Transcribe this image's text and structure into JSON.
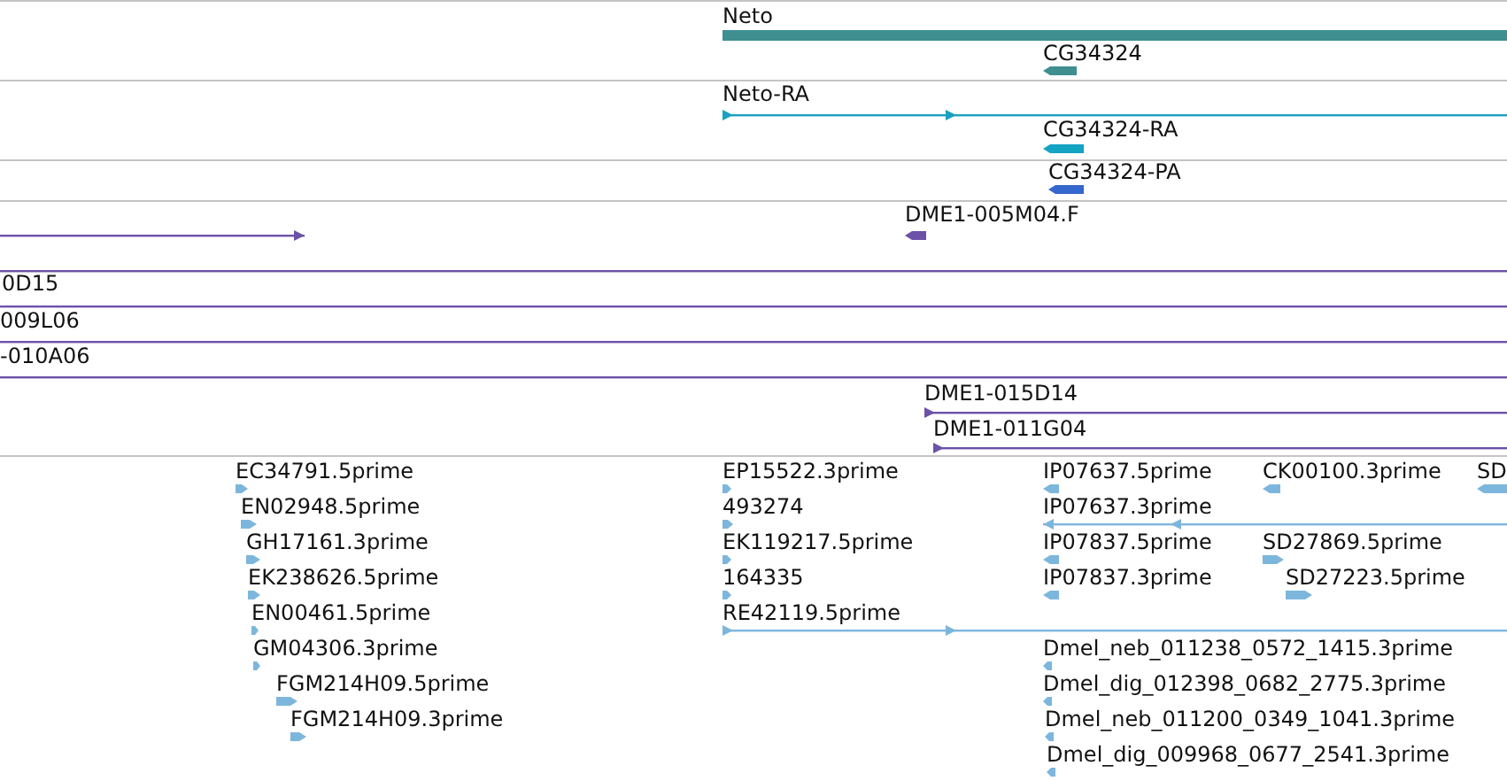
{
  "tracks": [
    {
      "features": [
        {
          "label": "Neto",
          "kind": "bar",
          "color": "#3f8f91"
        },
        {
          "label": "CG34324",
          "kind": "arrow",
          "reverse": true,
          "color": "#3f8f91"
        }
      ]
    },
    {
      "features": [
        {
          "label": "Neto-RA",
          "kind": "line",
          "reverse": false,
          "color": "#1aa0c0"
        },
        {
          "label": "CG34324-RA",
          "kind": "arrow",
          "reverse": true,
          "color": "#13a3c3"
        }
      ]
    },
    {
      "features": [
        {
          "label": "CG34324-PA",
          "kind": "arrow",
          "reverse": true,
          "color": "#3567cc"
        }
      ]
    },
    {
      "features": [
        {
          "kind": "line",
          "reverse": false,
          "color": "#6b52a8"
        },
        {
          "label": "DME1-005M04.F",
          "kind": "arrow",
          "reverse": true,
          "color": "#6b52a8"
        },
        {
          "kind": "line",
          "color": "#6b52a8"
        },
        {
          "label": "0D15",
          "kind": "line",
          "color": "#6b52a8"
        },
        {
          "label": "009L06",
          "kind": "line",
          "color": "#6b52a8"
        },
        {
          "label": "-010A06",
          "kind": "line",
          "color": "#6b52a8"
        },
        {
          "label": "DME1-015D14",
          "kind": "line",
          "reverse": false,
          "color": "#6b52a8"
        },
        {
          "label": "DME1-011G04",
          "kind": "line",
          "reverse": false,
          "color": "#6b52a8"
        }
      ]
    },
    {
      "features": [
        {
          "label": "EC34791.5prime",
          "kind": "arrow",
          "reverse": false,
          "color": "#7db6dc"
        },
        {
          "label": "EP15522.3prime",
          "kind": "arrow",
          "reverse": false,
          "color": "#7db6dc"
        },
        {
          "label": "IP07637.5prime",
          "kind": "arrow",
          "reverse": true,
          "color": "#7db6dc"
        },
        {
          "label": "CK00100.3prime",
          "kind": "arrow",
          "reverse": true,
          "color": "#7db6dc"
        },
        {
          "label": "SD",
          "kind": "arrow",
          "reverse": true,
          "color": "#7db6dc"
        },
        {
          "label": "EN02948.5prime",
          "kind": "arrow",
          "reverse": false,
          "color": "#7db6dc"
        },
        {
          "label": "493274",
          "kind": "arrow",
          "reverse": false,
          "color": "#7db6dc"
        },
        {
          "label": "IP07637.3prime",
          "kind": "line",
          "reverse": true,
          "color": "#7db6dc"
        },
        {
          "label": "GH17161.3prime",
          "kind": "arrow",
          "reverse": false,
          "color": "#7db6dc"
        },
        {
          "label": "EK119217.5prime",
          "kind": "arrow",
          "reverse": false,
          "color": "#7db6dc"
        },
        {
          "label": "IP07837.5prime",
          "kind": "arrow",
          "reverse": true,
          "color": "#7db6dc"
        },
        {
          "label": "SD27869.5prime",
          "kind": "arrow",
          "reverse": false,
          "color": "#7db6dc"
        },
        {
          "label": "EK238626.5prime",
          "kind": "arrow",
          "reverse": false,
          "color": "#7db6dc"
        },
        {
          "label": "164335",
          "kind": "arrow",
          "reverse": false,
          "color": "#7db6dc"
        },
        {
          "label": "IP07837.3prime",
          "kind": "arrow",
          "reverse": true,
          "color": "#7db6dc"
        },
        {
          "label": "SD27223.5prime",
          "kind": "arrow",
          "reverse": false,
          "color": "#7db6dc"
        },
        {
          "label": "EN00461.5prime",
          "kind": "arrow",
          "reverse": false,
          "color": "#7db6dc"
        },
        {
          "label": "RE42119.5prime",
          "kind": "line",
          "reverse": false,
          "color": "#7db6dc"
        },
        {
          "label": "GM04306.3prime",
          "kind": "arrow",
          "reverse": false,
          "color": "#7db6dc"
        },
        {
          "label": "Dmel_neb_011238_0572_1415.3prime",
          "kind": "arrow",
          "reverse": true,
          "color": "#7db6dc"
        },
        {
          "label": "FGM214H09.5prime",
          "kind": "arrow",
          "reverse": false,
          "color": "#7db6dc"
        },
        {
          "label": "Dmel_dig_012398_0682_2775.3prime",
          "kind": "arrow",
          "reverse": true,
          "color": "#7db6dc"
        },
        {
          "label": "FGM214H09.3prime",
          "kind": "arrow",
          "reverse": false,
          "color": "#7db6dc"
        },
        {
          "label": "Dmel_neb_011200_0349_1041.3prime",
          "kind": "arrow",
          "reverse": true,
          "color": "#7db6dc"
        },
        {
          "label": "Dmel_dig_009968_0677_2541.3prime",
          "kind": "arrow",
          "reverse": true,
          "color": "#7db6dc"
        }
      ]
    }
  ]
}
